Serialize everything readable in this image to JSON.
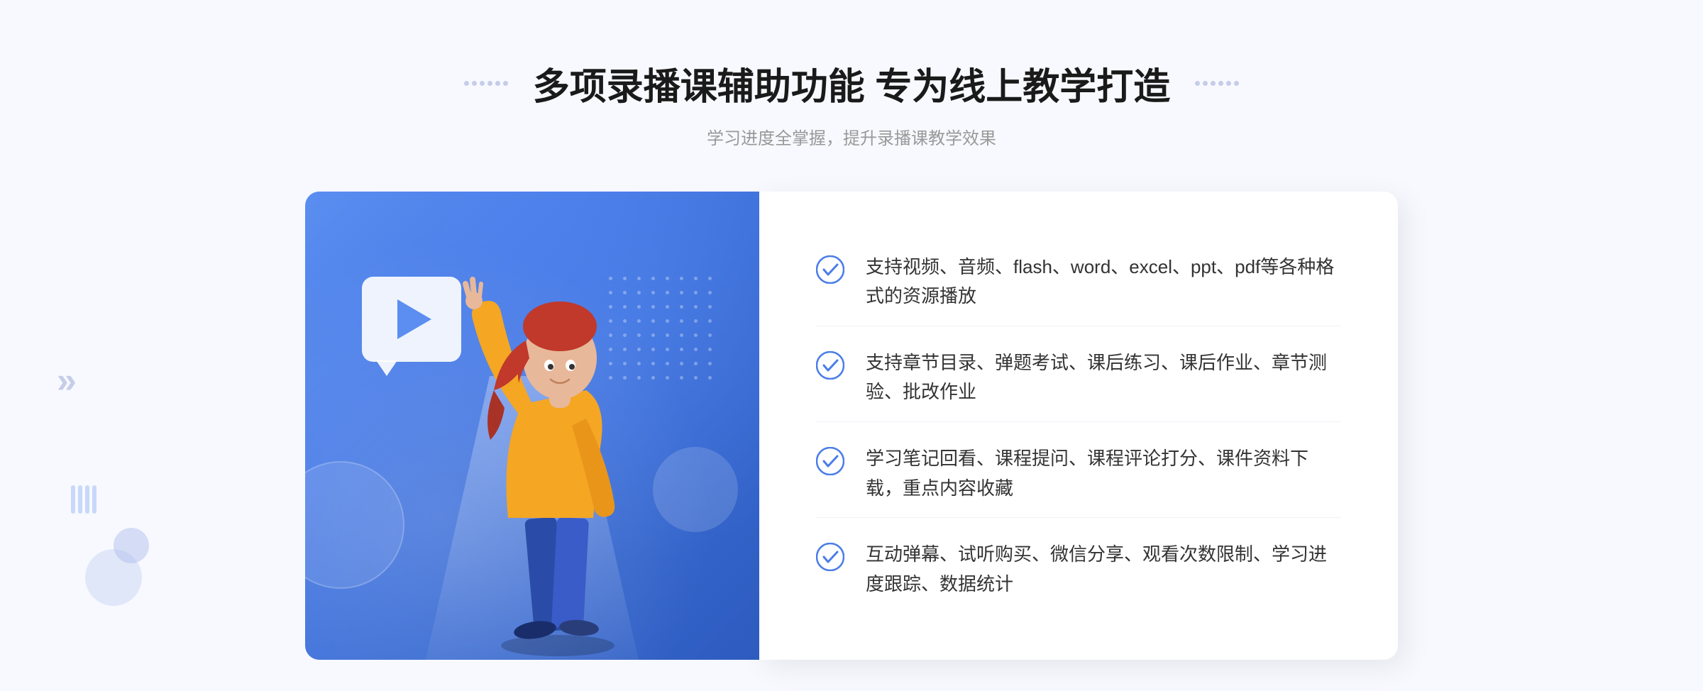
{
  "header": {
    "title": "多项录播课辅助功能 专为线上教学打造",
    "subtitle": "学习进度全掌握，提升录播课教学效果"
  },
  "features": [
    {
      "id": 1,
      "text": "支持视频、音频、flash、word、excel、ppt、pdf等各种格式的资源播放"
    },
    {
      "id": 2,
      "text": "支持章节目录、弹题考试、课后练习、课后作业、章节测验、批改作业"
    },
    {
      "id": 3,
      "text": "学习笔记回看、课程提问、课程评论打分、课件资料下载，重点内容收藏"
    },
    {
      "id": 4,
      "text": "互动弹幕、试听购买、微信分享、观看次数限制、学习进度跟踪、数据统计"
    }
  ],
  "colors": {
    "primary": "#4a7de8",
    "check": "#4a7de8",
    "text_main": "#333333",
    "text_sub": "#999999",
    "title": "#1a1a1a"
  }
}
